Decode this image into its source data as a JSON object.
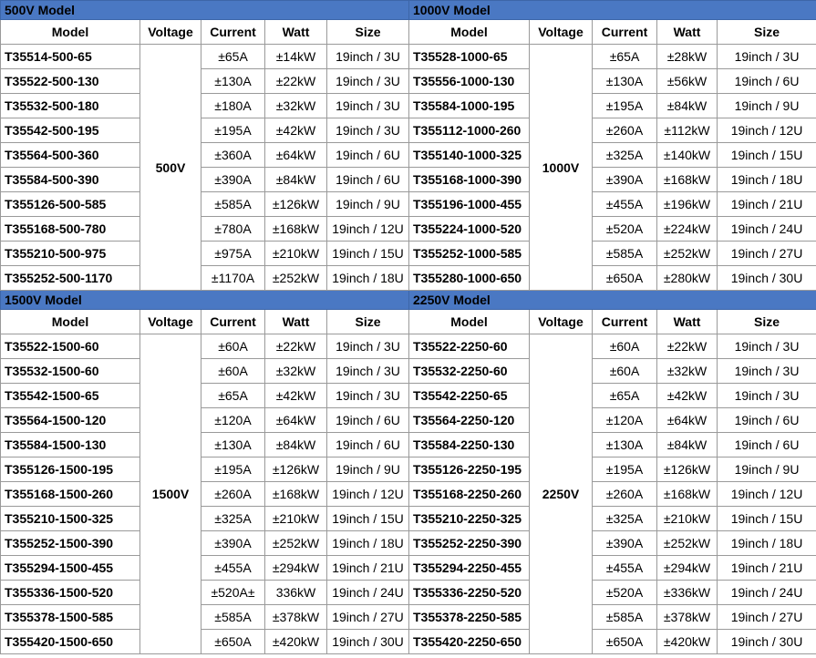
{
  "columns": [
    "Model",
    "Voltage",
    "Current",
    "Watt",
    "Size"
  ],
  "blocks": [
    {
      "left": {
        "title": "500V Model",
        "voltage": "500V",
        "rows": [
          [
            "T35514-500-65",
            "±65A",
            "±14kW",
            "19inch / 3U"
          ],
          [
            "T35522-500-130",
            "±130A",
            "±22kW",
            "19inch / 3U"
          ],
          [
            "T35532-500-180",
            "±180A",
            "±32kW",
            "19inch / 3U"
          ],
          [
            "T35542-500-195",
            "±195A",
            "±42kW",
            "19inch / 3U"
          ],
          [
            "T35564-500-360",
            "±360A",
            "±64kW",
            "19inch / 6U"
          ],
          [
            "T35584-500-390",
            "±390A",
            "±84kW",
            "19inch / 6U"
          ],
          [
            "T355126-500-585",
            "±585A",
            "±126kW",
            "19inch / 9U"
          ],
          [
            "T355168-500-780",
            "±780A",
            "±168kW",
            "19inch / 12U"
          ],
          [
            "T355210-500-975",
            "±975A",
            "±210kW",
            "19inch / 15U"
          ],
          [
            "T355252-500-1170",
            "±1170A",
            "±252kW",
            "19inch / 18U"
          ]
        ]
      },
      "right": {
        "title": "1000V Model",
        "voltage": "1000V",
        "rows": [
          [
            "T35528-1000-65",
            "±65A",
            "±28kW",
            "19inch / 3U"
          ],
          [
            "T35556-1000-130",
            "±130A",
            "±56kW",
            "19inch / 6U"
          ],
          [
            "T35584-1000-195",
            "±195A",
            "±84kW",
            "19inch / 9U"
          ],
          [
            "T355112-1000-260",
            "±260A",
            "±112kW",
            "19inch / 12U"
          ],
          [
            "T355140-1000-325",
            "±325A",
            "±140kW",
            "19inch / 15U"
          ],
          [
            "T355168-1000-390",
            "±390A",
            "±168kW",
            "19inch / 18U"
          ],
          [
            "T355196-1000-455",
            "±455A",
            "±196kW",
            "19inch / 21U"
          ],
          [
            "T355224-1000-520",
            "±520A",
            "±224kW",
            "19inch / 24U"
          ],
          [
            "T355252-1000-585",
            "±585A",
            "±252kW",
            "19inch / 27U"
          ],
          [
            "T355280-1000-650",
            "±650A",
            "±280kW",
            "19inch / 30U"
          ]
        ]
      }
    },
    {
      "left": {
        "title": "1500V Model",
        "voltage": "1500V",
        "rows": [
          [
            "T35522-1500-60",
            "±60A",
            "±22kW",
            "19inch / 3U"
          ],
          [
            "T35532-1500-60",
            "±60A",
            "±32kW",
            "19inch / 3U"
          ],
          [
            "T35542-1500-65",
            "±65A",
            "±42kW",
            "19inch / 3U"
          ],
          [
            "T35564-1500-120",
            "±120A",
            "±64kW",
            "19inch / 6U"
          ],
          [
            "T35584-1500-130",
            "±130A",
            "±84kW",
            "19inch / 6U"
          ],
          [
            "T355126-1500-195",
            "±195A",
            "±126kW",
            "19inch / 9U"
          ],
          [
            "T355168-1500-260",
            "±260A",
            "±168kW",
            "19inch / 12U"
          ],
          [
            "T355210-1500-325",
            "±325A",
            "±210kW",
            "19inch / 15U"
          ],
          [
            "T355252-1500-390",
            "±390A",
            "±252kW",
            "19inch / 18U"
          ],
          [
            "T355294-1500-455",
            "±455A",
            "±294kW",
            "19inch / 21U"
          ],
          [
            "T355336-1500-520",
            "±520A±",
            "336kW",
            "19inch / 24U"
          ],
          [
            "T355378-1500-585",
            "±585A",
            "±378kW",
            "19inch / 27U"
          ],
          [
            "T355420-1500-650",
            "±650A",
            "±420kW",
            "19inch / 30U"
          ]
        ]
      },
      "right": {
        "title": "2250V Model",
        "voltage": "2250V",
        "rows": [
          [
            "T35522-2250-60",
            "±60A",
            "±22kW",
            "19inch / 3U"
          ],
          [
            "T35532-2250-60",
            "±60A",
            "±32kW",
            "19inch / 3U"
          ],
          [
            "T35542-2250-65",
            "±65A",
            "±42kW",
            "19inch / 3U"
          ],
          [
            "T35564-2250-120",
            "±120A",
            "±64kW",
            "19inch / 6U"
          ],
          [
            "T35584-2250-130",
            "±130A",
            "±84kW",
            "19inch / 6U"
          ],
          [
            "T355126-2250-195",
            "±195A",
            "±126kW",
            "19inch / 9U"
          ],
          [
            "T355168-2250-260",
            "±260A",
            "±168kW",
            "19inch / 12U"
          ],
          [
            "T355210-2250-325",
            "±325A",
            "±210kW",
            "19inch / 15U"
          ],
          [
            "T355252-2250-390",
            "±390A",
            "±252kW",
            "19inch / 18U"
          ],
          [
            "T355294-2250-455",
            "±455A",
            "±294kW",
            "19inch / 21U"
          ],
          [
            "T355336-2250-520",
            "±520A",
            "±336kW",
            "19inch / 24U"
          ],
          [
            "T355378-2250-585",
            "±585A",
            "±378kW",
            "19inch / 27U"
          ],
          [
            "T355420-2250-650",
            "±650A",
            "±420kW",
            "19inch / 30U"
          ]
        ]
      }
    }
  ]
}
